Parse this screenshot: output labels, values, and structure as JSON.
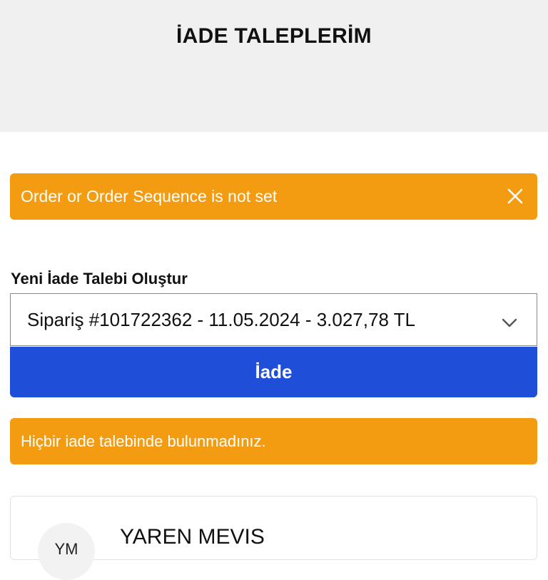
{
  "header": {
    "title": "İADE TALEPLERİM"
  },
  "alerts": {
    "error_message": "Order or Order Sequence is not set",
    "info_message": "Hiçbir iade talebinde bulunmadınız."
  },
  "form": {
    "label": "Yeni İade Talebi Oluştur",
    "order_select_value": "Sipariş #101722362 - 11.05.2024 - 3.027,78 TL",
    "submit_label": "İade"
  },
  "user": {
    "initials": "YM",
    "name": "YAREN MEVIS"
  },
  "colors": {
    "alert": "#f39c12",
    "button": "#1f4fd8",
    "header_bg": "#f0f0f0"
  },
  "icons": {
    "close": "close-icon",
    "dropdown": "chevron-down-icon"
  }
}
